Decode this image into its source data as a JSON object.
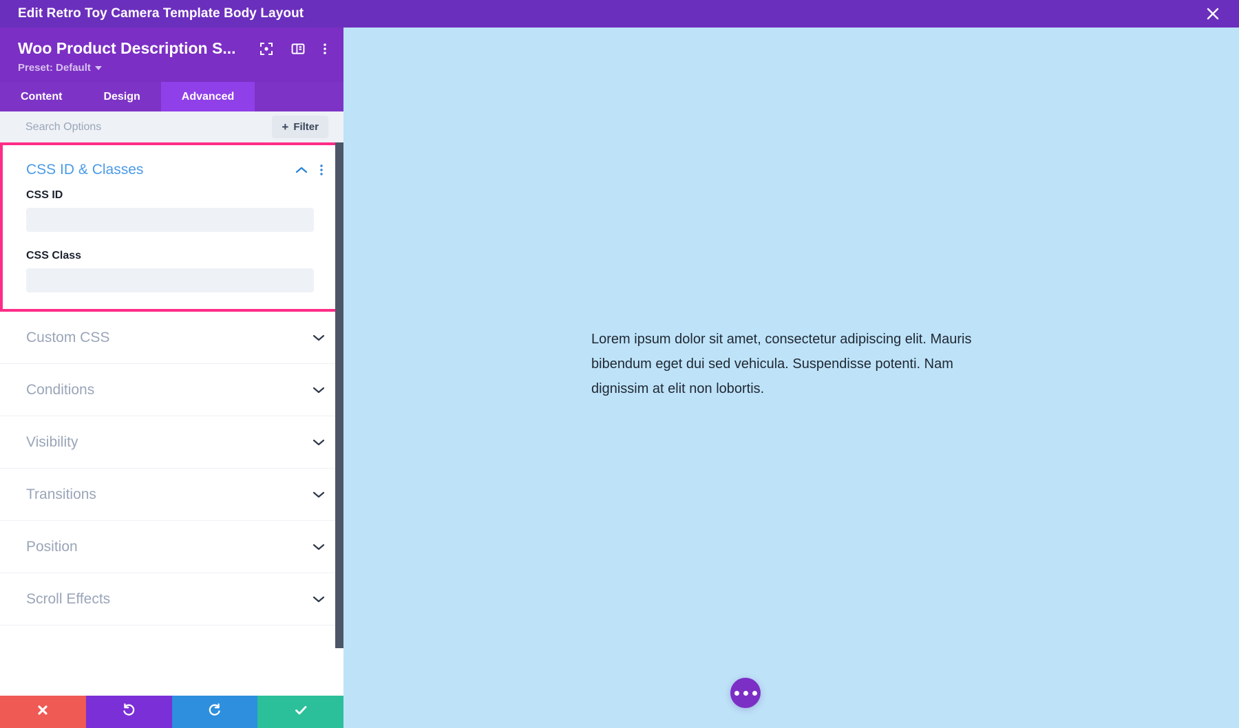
{
  "window": {
    "title": "Edit Retro Toy Camera Template Body Layout",
    "close_icon": "close-icon"
  },
  "panel": {
    "module_title": "Woo Product Description S...",
    "preset_label": "Preset: Default",
    "header_icons": [
      {
        "name": "focus-target-icon"
      },
      {
        "name": "layout-columns-icon"
      },
      {
        "name": "kebab-menu-icon"
      }
    ],
    "tabs": [
      {
        "label": "Content",
        "active": false
      },
      {
        "label": "Design",
        "active": false
      },
      {
        "label": "Advanced",
        "active": true
      }
    ],
    "search": {
      "placeholder": "Search Options",
      "value": ""
    },
    "filter_button": {
      "label": "Filter",
      "icon": "plus-icon"
    },
    "open_group": {
      "title": "CSS ID & Classes",
      "collapse_icon": "chevron-up-icon",
      "kebab_icon": "kebab-menu-icon",
      "highlighted": true,
      "highlight_color": "#ff2d87",
      "fields": [
        {
          "label": "CSS ID",
          "value": "",
          "placeholder": ""
        },
        {
          "label": "CSS Class",
          "value": "",
          "placeholder": ""
        }
      ]
    },
    "groups": [
      {
        "label": "Custom CSS",
        "icon": "chevron-down-icon"
      },
      {
        "label": "Conditions",
        "icon": "chevron-down-icon"
      },
      {
        "label": "Visibility",
        "icon": "chevron-down-icon"
      },
      {
        "label": "Transitions",
        "icon": "chevron-down-icon"
      },
      {
        "label": "Position",
        "icon": "chevron-down-icon"
      },
      {
        "label": "Scroll Effects",
        "icon": "chevron-down-icon"
      }
    ],
    "actions": [
      {
        "name": "cancel-button",
        "icon": "x-icon",
        "color": "#ef5a54"
      },
      {
        "name": "undo-button",
        "icon": "undo-arrow-icon",
        "color": "#7b2fd6"
      },
      {
        "name": "redo-button",
        "icon": "redo-arrow-icon",
        "color": "#2d8fdd"
      },
      {
        "name": "save-button",
        "icon": "check-icon",
        "color": "#2bbf9a"
      }
    ]
  },
  "canvas": {
    "background_color": "#bee3f8",
    "body_text": "Lorem ipsum dolor sit amet, consectetur adipiscing elit. Mauris bibendum eget dui sed vehicula. Suspendisse potenti. Nam dignissim at elit non lobortis.",
    "fab": {
      "name": "more-options-fab",
      "icon": "ellipsis-icon",
      "color": "#7b2fc4"
    }
  },
  "theme": {
    "purple_dark": "#6b2fbd",
    "purple": "#7b2fc4",
    "purple_tab": "#7d34c6",
    "purple_tab_active": "#9040e8",
    "blue_link": "#4a9ae8",
    "pink_highlight": "#ff2d87"
  }
}
